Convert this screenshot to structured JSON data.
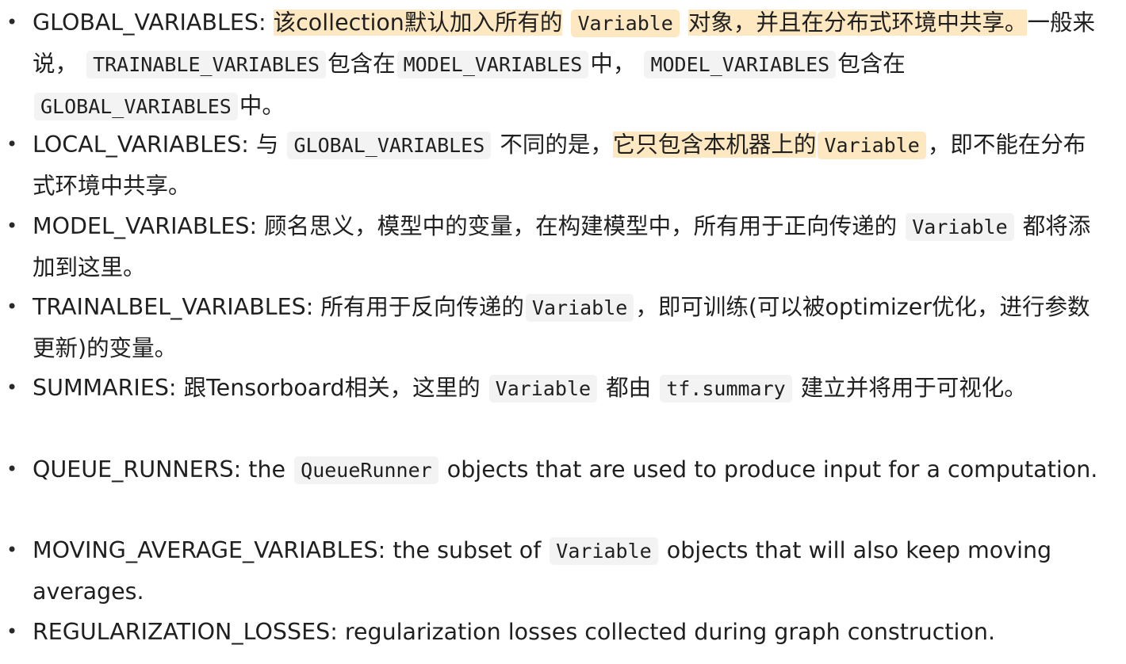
{
  "colors": {
    "text": "#1f1f1f",
    "highlight": "#fde8c1",
    "code_background": "#f3f3f3"
  },
  "bullet_glyph": "•",
  "items": [
    {
      "key": "GLOBAL_VARIABLES:",
      "hl_1": "该collection默认加入所有的",
      "code_1": "Variable",
      "hl_2": "对象，并且在分布式环境中共享。",
      "t1": "一般来说，",
      "code_2": "TRAINABLE_VARIABLES",
      "t2": "包含在",
      "code_3": "MODEL_VARIABLES",
      "t3": "中，",
      "code_4": "MODEL_VARIABLES",
      "t4": "包含在",
      "code_5": "GLOBAL_VARIABLES",
      "t5": "中。"
    },
    {
      "key": "LOCAL_VARIABLES:",
      "t1": "与",
      "code_1": "GLOBAL_VARIABLES",
      "t2": "不同的是，",
      "hl_1": "它只包含本机器上的",
      "code_2": "Variable",
      "t3": "，即不能在分布式环境中共享。"
    },
    {
      "key": "MODEL_VARIABLES:",
      "t1": "顾名思义，模型中的变量，在构建模型中，所有用于正向传递的",
      "code_1": "Variable",
      "t2": "都将添加到这里。"
    },
    {
      "key": "TRAINALBEL_VARIABLES:",
      "t1": "所有用于反向传递的",
      "code_1": "Variable",
      "t2": "，即可训练(可以被optimizer优化，进行参数更新)的变量。"
    },
    {
      "key": "SUMMARIES:",
      "t1": "跟Tensorboard相关，这里的",
      "code_1": "Variable",
      "t2": "都由",
      "code_2": "tf.summary",
      "t3": "建立并将用于可视化。"
    },
    {
      "key": "QUEUE_RUNNERS:",
      "t1": "the",
      "code_1": "QueueRunner",
      "t2": "objects that are used to produce input for a computation."
    },
    {
      "key": "MOVING_AVERAGE_VARIABLES:",
      "t1": "the subset of",
      "code_1": "Variable",
      "t2": "objects that will also keep moving averages."
    },
    {
      "key": "REGULARIZATION_LOSSES:",
      "t1": "regularization losses collected during graph construction."
    }
  ]
}
